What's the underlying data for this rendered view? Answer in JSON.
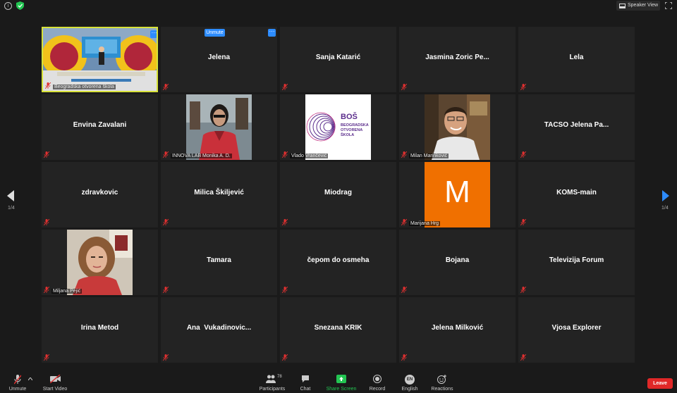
{
  "topbar": {
    "speaker_view_label": "Speaker View"
  },
  "tiles": [
    {
      "name": "",
      "caption": "Beogradska otvorena škola"
    },
    {
      "name": "Jelena",
      "caption": ""
    },
    {
      "name": "Sanja Katarić",
      "caption": ""
    },
    {
      "name": "Jasmina Zoric Pe...",
      "caption": ""
    },
    {
      "name": "Lela",
      "caption": ""
    },
    {
      "name": "Envina Zavalani",
      "caption": ""
    },
    {
      "name": "",
      "caption": "INNOVA LAB Monika A. D."
    },
    {
      "name": "",
      "caption": "Vlado Vrančević"
    },
    {
      "name": "",
      "caption": "Milan Marinković"
    },
    {
      "name": "TACSO Jelena Pa...",
      "caption": ""
    },
    {
      "name": "zdravkovic",
      "caption": ""
    },
    {
      "name": "Milica Škiljević",
      "caption": ""
    },
    {
      "name": "Miodrag",
      "caption": ""
    },
    {
      "name": "",
      "caption": "Marijana Hrg"
    },
    {
      "name": "KOMS-main",
      "caption": ""
    },
    {
      "name": "",
      "caption": "Miljana Pejić"
    },
    {
      "name": "Tamara",
      "caption": ""
    },
    {
      "name": "čepom do osmeha",
      "caption": ""
    },
    {
      "name": "Bojana",
      "caption": ""
    },
    {
      "name": "Televizija Forum",
      "caption": ""
    },
    {
      "name": "Irina Metod",
      "caption": ""
    },
    {
      "name": "Ana  Vukadinovic...",
      "caption": ""
    },
    {
      "name": "Snezana KRIK",
      "caption": ""
    },
    {
      "name": "Jelena Milković",
      "caption": ""
    },
    {
      "name": "Vjosa Explorer",
      "caption": ""
    }
  ],
  "tile_overlay": {
    "unmute_label": "Unmute",
    "more_label": "···"
  },
  "logos": {
    "bos_title": "BOŠ",
    "bos_line1": "BEOGRADSKA",
    "bos_line2": "OTVORENA",
    "bos_line3": "ŠKOLA",
    "avatar_letter": "M"
  },
  "pagination": {
    "left_label": "1/4",
    "right_label": "1/4"
  },
  "toolbar": {
    "unmute_label": "Unmute",
    "start_video_label": "Start Video",
    "participants_label": "Participants",
    "participants_count": "78",
    "chat_label": "Chat",
    "share_label": "Share Screen",
    "record_label": "Record",
    "language_label": "English",
    "language_code": "EN",
    "reactions_label": "Reactions",
    "leave_label": "Leave"
  },
  "colors": {
    "accent": "#2d8cff",
    "share_green": "#23c552",
    "leave_red": "#e02828",
    "active_border": "#d7e23a",
    "avatar_orange": "#f07000",
    "mic_muted": "#e03030"
  }
}
